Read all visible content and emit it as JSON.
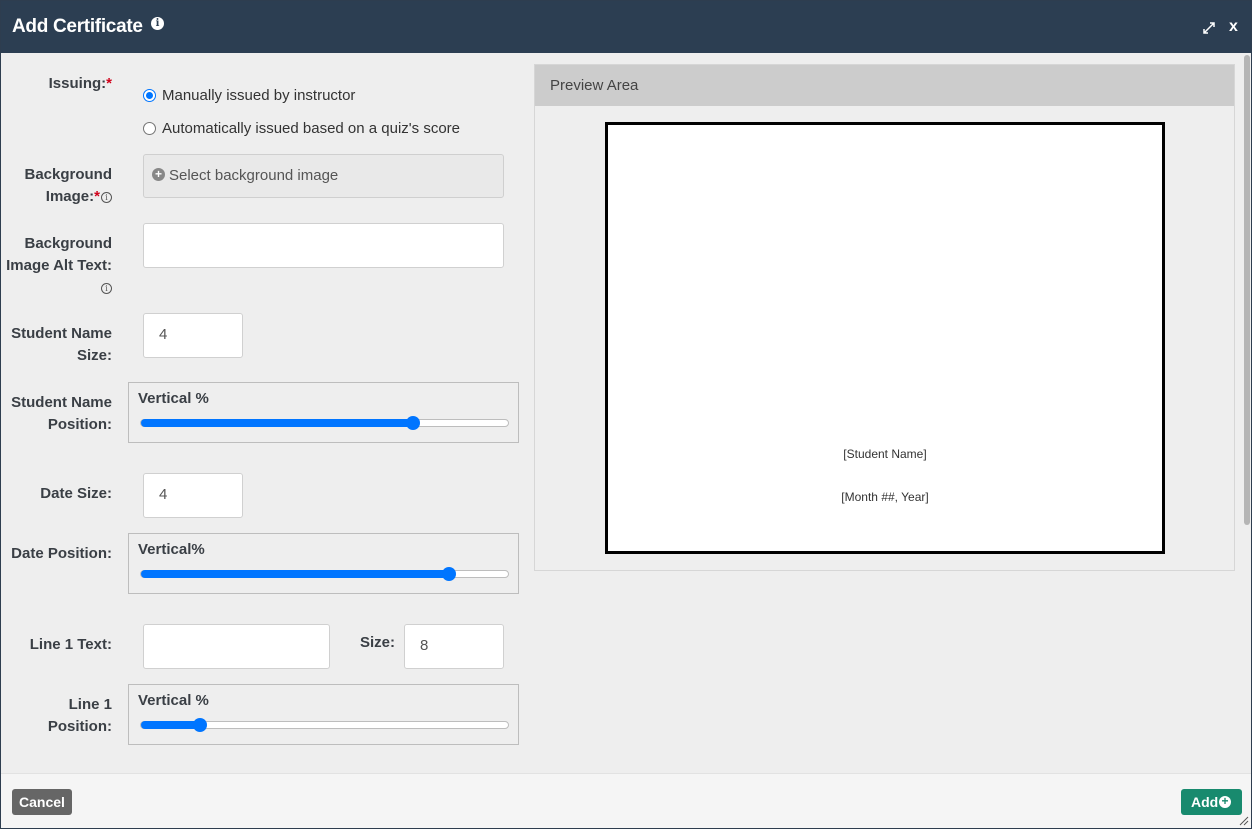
{
  "dialog": {
    "title": "Add Certificate",
    "close_label": "x"
  },
  "form": {
    "issuing": {
      "label": "Issuing:",
      "required_mark": "*",
      "options": [
        {
          "label": "Manually issued by instructor",
          "selected": true
        },
        {
          "label": "Automatically issued based on a quiz's score",
          "selected": false
        }
      ]
    },
    "background_image": {
      "label_line1": "Background",
      "label_line2": "Image:",
      "required_mark": "*",
      "button_label": "Select background image"
    },
    "background_alt": {
      "label_line1": "Background",
      "label_line2": "Image Alt Text:",
      "value": ""
    },
    "student_name_size": {
      "label_line1": "Student Name",
      "label_line2": "Size:",
      "value": "4"
    },
    "student_name_position": {
      "label_line1": "Student Name",
      "label_line2": "Position:",
      "caption": "Vertical %",
      "value_percent": 74
    },
    "date_size": {
      "label": "Date Size:",
      "value": "4"
    },
    "date_position": {
      "label": "Date Position:",
      "caption": "Vertical%",
      "value_percent": 84
    },
    "line1_text": {
      "label": "Line 1 Text:",
      "value": "",
      "size_label": "Size:",
      "size_value": "8"
    },
    "line1_position": {
      "label_line1": "Line 1",
      "label_line2": "Position:",
      "caption": "Vertical %",
      "value_percent": 16
    }
  },
  "preview": {
    "header": "Preview Area",
    "student_name_placeholder": "[Student Name]",
    "date_placeholder": "[Month ##, Year]"
  },
  "footer": {
    "cancel_label": "Cancel",
    "add_label": "Add"
  },
  "colors": {
    "header_bg": "#2c3e52",
    "accent": "#0075ff",
    "add_button": "#188a6e",
    "required": "#d0021b"
  }
}
